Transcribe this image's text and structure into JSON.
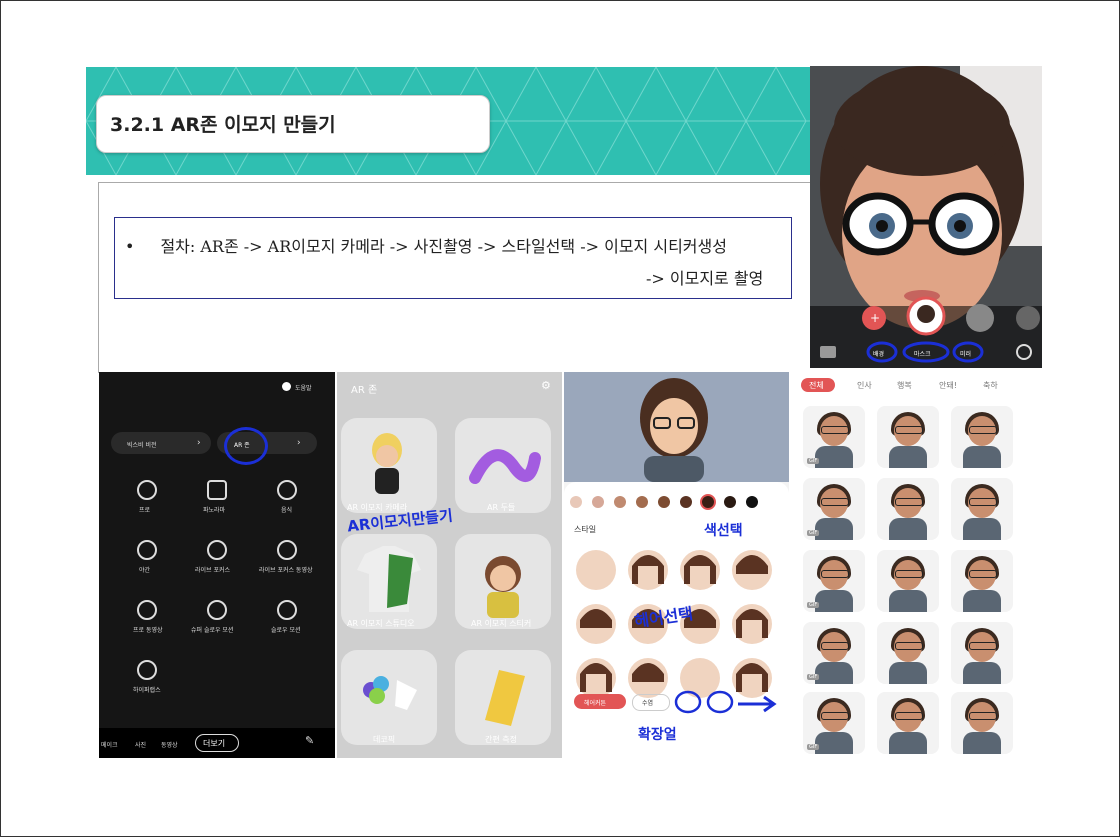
{
  "slide": {
    "title": "3.2.1 AR존 이모지 만들기",
    "bullet": "•",
    "procedure_line1": "절차: AR존 -> AR이모지 카메라 -> 사진촬영 -> 스타일선택 -> 이모지 시티커생성",
    "procedure_line2": "-> 이모지로 촬영"
  },
  "avatar_shot": {
    "mode_labels": [
      "배경",
      "마스크",
      "미러"
    ]
  },
  "camera_menu": {
    "help": "도움말",
    "bixby": "빅스비 비전",
    "ar_zone": "AR 존",
    "modes": [
      [
        "프로",
        "파노라마",
        "음식"
      ],
      [
        "야간",
        "라이브 포커스",
        "라이브 포커스 동영상"
      ],
      [
        "프로 동영상",
        "슈퍼 슬로우 모션",
        "슬로우 모션"
      ],
      [
        "하이퍼랩스"
      ]
    ],
    "bottom": [
      "메이크",
      "사진",
      "동영상",
      "더보기"
    ]
  },
  "ar_zone": {
    "title": "AR 존",
    "tiles": [
      "AR 이모지 카메라",
      "AR 두들",
      "AR 이모지 스튜디오",
      "AR 이모지 스티커",
      "데코픽",
      "간편 측정"
    ],
    "handwriting": "AR이모지만들기"
  },
  "style_screen": {
    "style_label": "스타일",
    "tabs": [
      "헤어커튼",
      "수염"
    ],
    "handwriting_color": "색선택",
    "handwriting_hair": "헤어선택",
    "handwriting_bottom": "확장얼"
  },
  "sticker_screen": {
    "tabs": [
      "전체",
      "인사",
      "행복",
      "안돼!",
      "축하"
    ],
    "gif": "GIF"
  }
}
